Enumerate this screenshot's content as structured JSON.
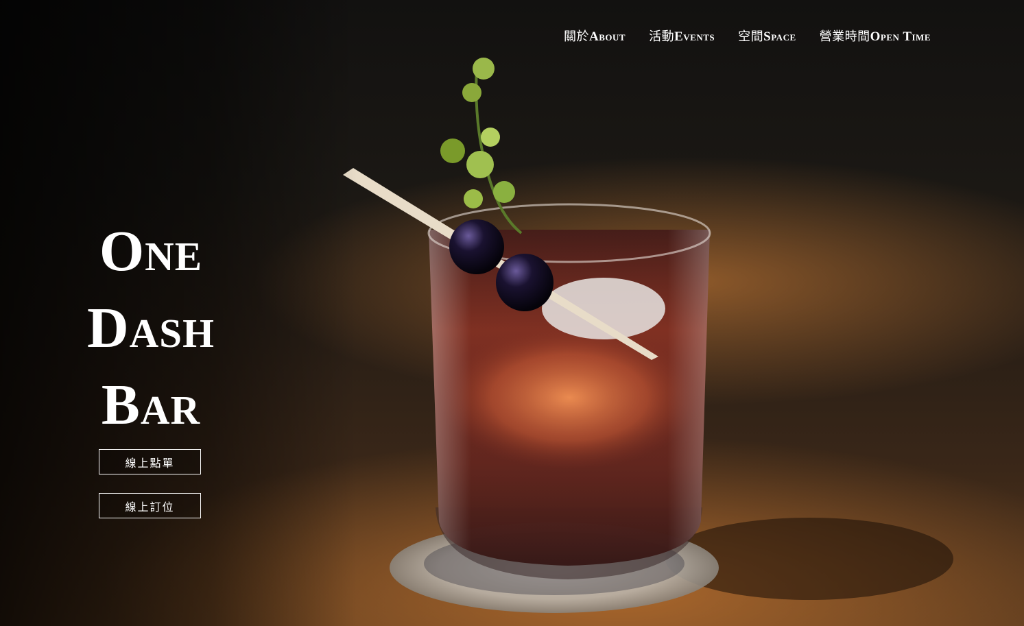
{
  "nav": {
    "items": [
      {
        "zh": "關於",
        "en": "About"
      },
      {
        "zh": "活動",
        "en": "Events"
      },
      {
        "zh": "空間",
        "en": "Space"
      },
      {
        "zh": "營業時間",
        "en": "Open Time"
      }
    ]
  },
  "brand": {
    "line1": "One",
    "line2": "Dash",
    "line3": "Bar"
  },
  "buttons": {
    "order_label": "線上點單",
    "reserve_label": "線上訂位"
  },
  "hero": {
    "image_subject": "cocktail-glass-photo"
  },
  "colors": {
    "text": "#ffffff",
    "amber_light": "#e08a3c",
    "liquid": "#6a1f14",
    "background_dark": "#0b0806"
  }
}
